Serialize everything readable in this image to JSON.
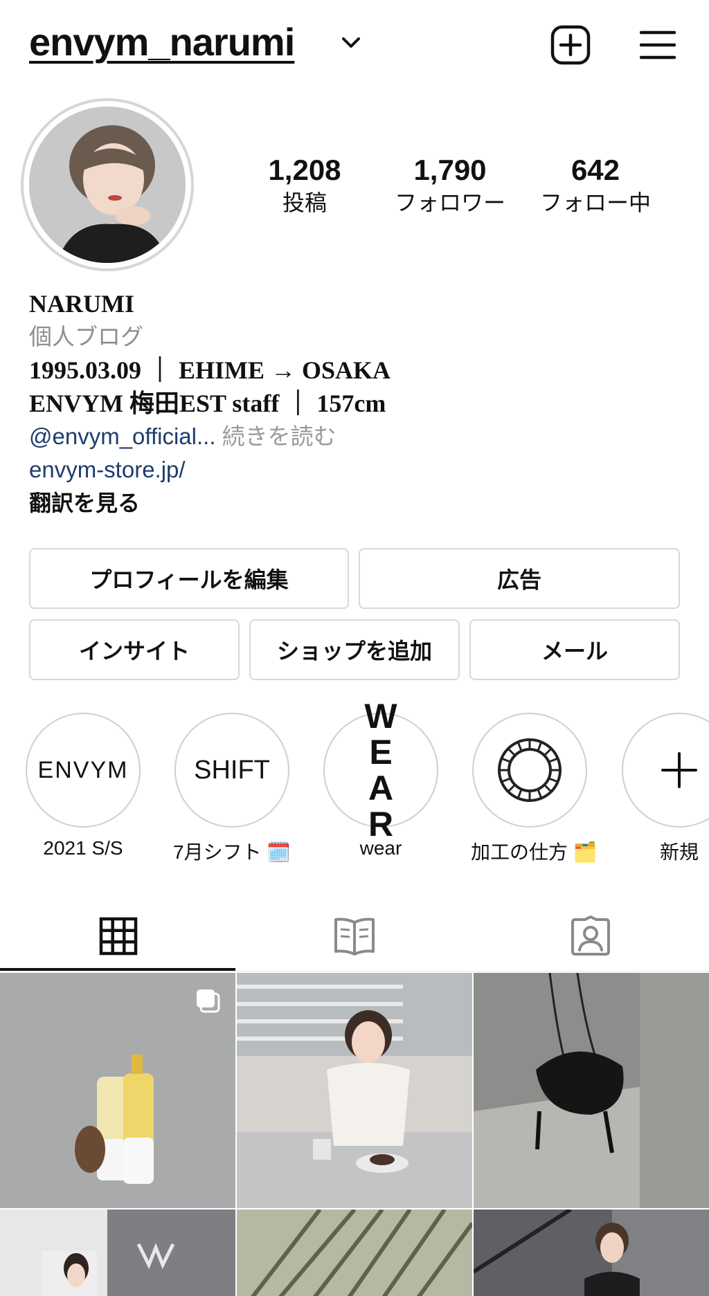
{
  "header": {
    "username": "envym_narumi"
  },
  "stats": [
    {
      "value": "1,208",
      "label": "投稿"
    },
    {
      "value": "1,790",
      "label": "フォロワー"
    },
    {
      "value": "642",
      "label": "フォロー中"
    }
  ],
  "bio": {
    "name": "NARUMI",
    "category": "個人ブログ",
    "line1": "1995.03.09 ｜ EHIME → OSAKA",
    "line2": "ENVYM 梅田EST staff ｜ 157cm",
    "mention": "@envym_official...",
    "more": " 続きを読む",
    "website": "envym-store.jp/",
    "translate": "翻訳を見る"
  },
  "buttons": {
    "edit_profile": "プロフィールを編集",
    "ads": "広告",
    "insights": "インサイト",
    "add_shop": "ショップを追加",
    "email": "メール"
  },
  "highlights": [
    {
      "label": "2021 S/S",
      "cover_text": "ENVYM"
    },
    {
      "label": "7月シフト 🗓️",
      "cover_text": "SHIFT"
    },
    {
      "label": "wear",
      "cover_text_line1": "W E",
      "cover_text_line2": "A R"
    },
    {
      "label": "加工の仕方 🗂️",
      "cover_icon": "vsco-ring-icon"
    },
    {
      "label": "新規",
      "cover_icon": "plus-icon"
    }
  ],
  "tabs": [
    {
      "name": "grid",
      "icon": "grid-icon",
      "active": true
    },
    {
      "name": "guides",
      "icon": "guide-book-icon",
      "active": false
    },
    {
      "name": "tagged",
      "icon": "tagged-person-icon",
      "active": false
    }
  ],
  "posts": [
    {
      "alt": "yellow and white product bottles",
      "multi": true
    },
    {
      "alt": "woman with dessert at table",
      "multi": false
    },
    {
      "alt": "black drawstring bag on concrete",
      "multi": false
    },
    {
      "alt": "woman at café storefront",
      "multi": false
    },
    {
      "alt": "palm leaves",
      "multi": false
    },
    {
      "alt": "woman on staircase",
      "multi": false
    }
  ],
  "colors": {
    "link": "#1d3d6b",
    "muted": "#8e8e8e",
    "border": "#d8d8d8"
  }
}
